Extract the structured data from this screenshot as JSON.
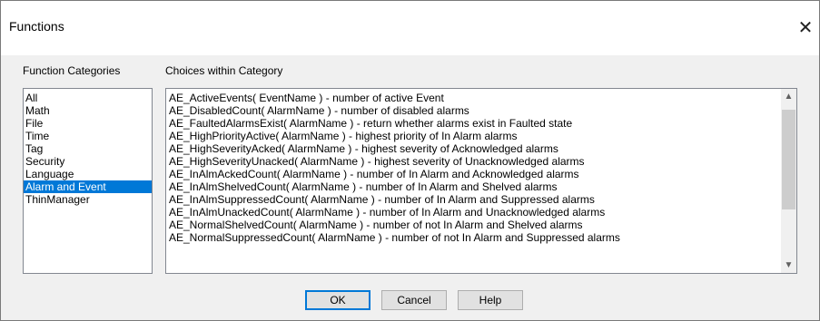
{
  "window": {
    "title": "Functions",
    "close_icon": "close-icon"
  },
  "categories": {
    "label": "Function Categories",
    "items": [
      "All",
      "Math",
      "File",
      "Time",
      "Tag",
      "Security",
      "Language",
      "Alarm and Event",
      "ThinManager"
    ],
    "selected": "Alarm and Event"
  },
  "choices": {
    "label": "Choices within Category",
    "items": [
      "AE_ActiveEvents( EventName ) - number of active Event",
      "AE_DisabledCount( AlarmName ) - number of disabled alarms",
      "AE_FaultedAlarmsExist( AlarmName ) - return whether alarms exist in Faulted state",
      "AE_HighPriorityActive( AlarmName ) - highest priority of In Alarm alarms",
      "AE_HighSeverityAcked( AlarmName ) - highest severity of Acknowledged alarms",
      "AE_HighSeverityUnacked( AlarmName ) - highest severity of Unacknowledged alarms",
      "AE_InAlmAckedCount( AlarmName ) - number of In Alarm and Acknowledged alarms",
      "AE_InAlmShelvedCount( AlarmName ) - number of In Alarm and Shelved alarms",
      "AE_InAlmSuppressedCount( AlarmName ) - number of In Alarm and Suppressed alarms",
      "AE_InAlmUnackedCount( AlarmName ) - number of In Alarm and Unacknowledged alarms",
      "AE_NormalShelvedCount( AlarmName ) - number of not In Alarm and Shelved alarms",
      "AE_NormalSuppressedCount( AlarmName ) - number of not In Alarm and Suppressed alarms"
    ]
  },
  "buttons": {
    "ok": "OK",
    "cancel": "Cancel",
    "help": "Help"
  },
  "colors": {
    "selection": "#0078d7",
    "default_button_border": "#0078d7"
  }
}
